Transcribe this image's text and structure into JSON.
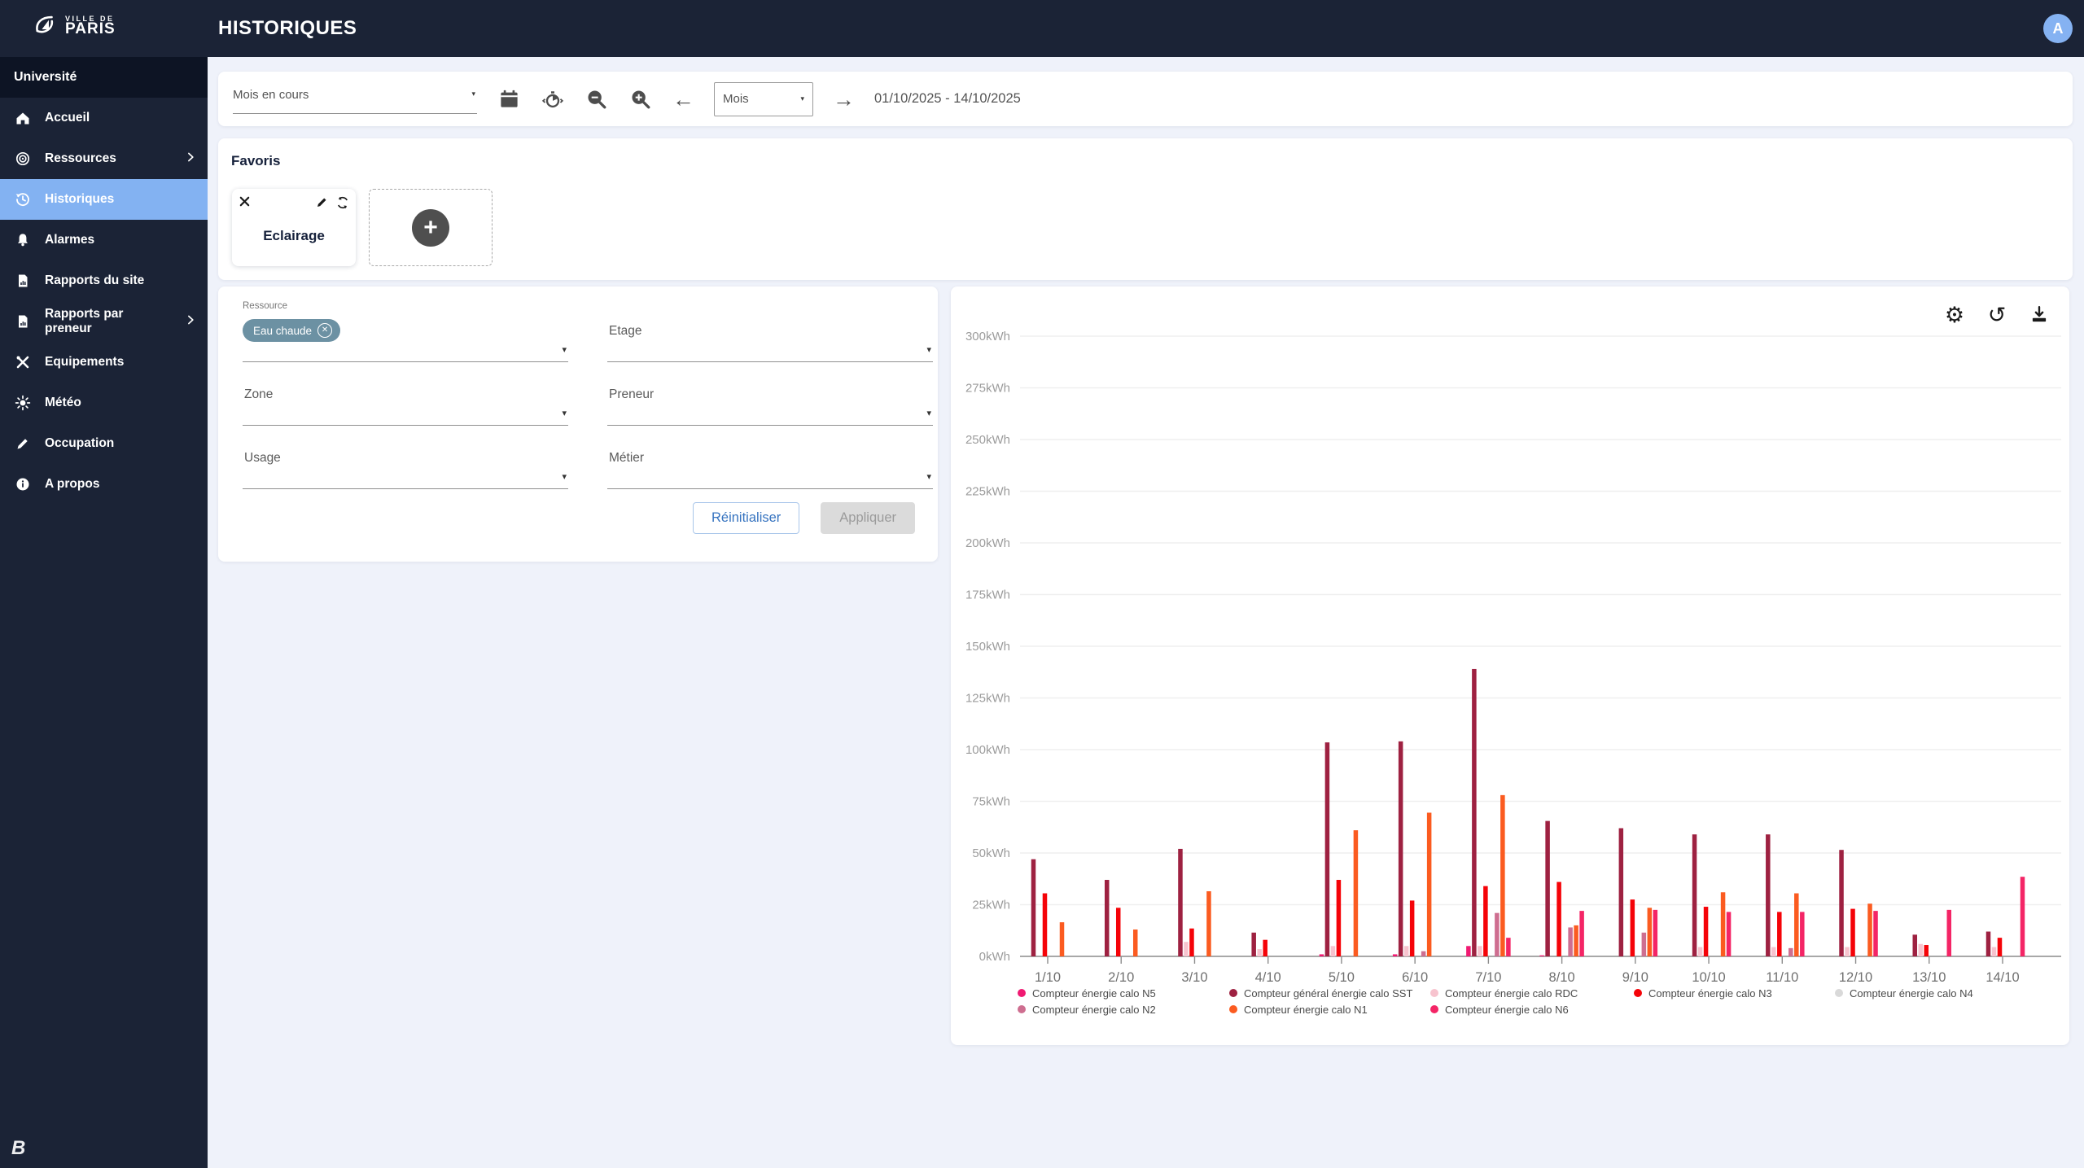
{
  "topbar": {
    "title": "HISTORIQUES",
    "logo_line1": "VILLE DE",
    "logo_line2": "PARIS",
    "avatar_initial": "A"
  },
  "sidebar": {
    "org": "Université",
    "items": [
      {
        "label": "Accueil"
      },
      {
        "label": "Ressources"
      },
      {
        "label": "Historiques"
      },
      {
        "label": "Alarmes"
      },
      {
        "label": "Rapports du site"
      },
      {
        "label": "Rapports par preneur"
      },
      {
        "label": "Equipements"
      },
      {
        "label": "Météo"
      },
      {
        "label": "Occupation"
      },
      {
        "label": "A propos"
      }
    ]
  },
  "toolbar": {
    "period_value": "Mois en cours",
    "granularity_value": "Mois",
    "date_range": "01/10/2025 - 14/10/2025"
  },
  "favorites": {
    "heading": "Favoris",
    "card_label": "Eclairage"
  },
  "filters": {
    "resource_label": "Ressource",
    "resource_chip": "Eau chaude",
    "field_etage": "Etage",
    "field_zone": "Zone",
    "field_preneur": "Preneur",
    "field_usage": "Usage",
    "field_metier": "Métier",
    "reset_label": "Réinitialiser",
    "apply_label": "Appliquer"
  },
  "chart_data": {
    "type": "bar",
    "unit": "kWh",
    "ylim": [
      0,
      300
    ],
    "ytick_step": 25,
    "grid": true,
    "legend_position": "bottom",
    "x": [
      "1/10",
      "2/10",
      "3/10",
      "4/10",
      "5/10",
      "6/10",
      "7/10",
      "8/10",
      "9/10",
      "10/10",
      "11/10",
      "12/10",
      "13/10",
      "14/10"
    ],
    "series": [
      {
        "name": "Compteur énergie calo N5",
        "color": "#F01A72",
        "values": [
          0,
          0,
          0,
          0,
          1,
          1,
          5,
          0.5,
          0,
          0,
          0,
          0,
          0,
          0
        ]
      },
      {
        "name": "Compteur général énergie calo SST",
        "color": "#9E2141",
        "values": [
          47,
          37,
          52,
          11.5,
          103.5,
          104,
          139,
          65.5,
          62,
          59,
          59,
          51.5,
          10.5,
          12
        ]
      },
      {
        "name": "Compteur énergie calo RDC",
        "color": "#F7C3CE",
        "values": [
          0,
          0,
          7,
          3.5,
          5,
          5,
          5,
          0,
          0,
          4.5,
          4.5,
          4.5,
          6,
          4.5
        ]
      },
      {
        "name": "Compteur énergie calo N3",
        "color": "#F50308",
        "values": [
          30.5,
          23.5,
          13.5,
          8,
          37,
          27,
          34,
          36,
          27.5,
          24,
          21.5,
          23,
          5.5,
          9
        ]
      },
      {
        "name": "Compteur énergie calo N4",
        "color": "#D9D9D9",
        "values": [
          0,
          0,
          0,
          0,
          0,
          0,
          0,
          0,
          0,
          0,
          0,
          0,
          0,
          0
        ]
      },
      {
        "name": "Compteur énergie calo N2",
        "color": "#CE6E90",
        "values": [
          0,
          0,
          0,
          0,
          0,
          2.5,
          21,
          14,
          11.5,
          0,
          4,
          0,
          0,
          0
        ]
      },
      {
        "name": "Compteur énergie calo N1",
        "color": "#FB5B20",
        "values": [
          16.5,
          13,
          31.5,
          0,
          61,
          69.5,
          78,
          15,
          23.5,
          31,
          30.5,
          25.5,
          0,
          0
        ]
      },
      {
        "name": "Compteur énergie calo N6",
        "color": "#F42566",
        "values": [
          0,
          0,
          0,
          0,
          0,
          0,
          9,
          22,
          22.5,
          21.5,
          21.5,
          22,
          22.5,
          38.5
        ]
      }
    ]
  }
}
